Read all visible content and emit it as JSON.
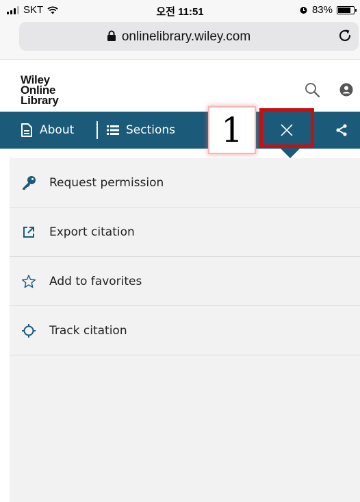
{
  "status_bar": {
    "carrier": "SKT",
    "time": "오전 11:51",
    "battery_percent": "83%",
    "battery_level": 0.83
  },
  "browser": {
    "url": "onlinelibrary.wiley.com"
  },
  "site": {
    "logo_lines": [
      "Wiley",
      "Online",
      "Library"
    ]
  },
  "toolbar": {
    "about_label": "About",
    "sections_label": "Sections"
  },
  "annotation": {
    "step_number": "1"
  },
  "menu": {
    "items": [
      {
        "label": "Request permission",
        "icon": "key-icon"
      },
      {
        "label": "Export citation",
        "icon": "external-link-icon"
      },
      {
        "label": "Add to favorites",
        "icon": "star-outline-icon"
      },
      {
        "label": "Track citation",
        "icon": "crosshair-icon"
      }
    ]
  },
  "colors": {
    "toolbar_blue": "#1b5a78",
    "icon_blue": "#1b5a78",
    "highlight_red": "#c81010",
    "menu_bg": "#f2f2f2"
  }
}
